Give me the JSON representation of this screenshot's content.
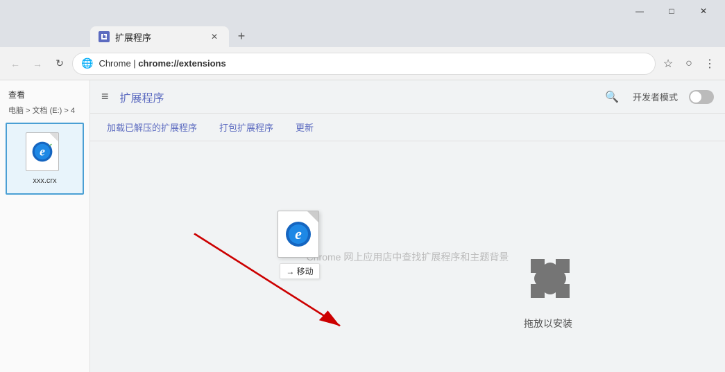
{
  "window": {
    "title": "扩展程序",
    "controls": {
      "minimize": "—",
      "maximize": "□",
      "close": "✕"
    }
  },
  "tab": {
    "icon": "puzzle",
    "title": "扩展程序",
    "close": "✕",
    "new_tab": "+"
  },
  "address_bar": {
    "back": "←",
    "forward": "→",
    "reload": "↻",
    "url_prefix": "Chrome | ",
    "url_bold": "chrome://extensions",
    "star": "☆",
    "account": "○",
    "menu": "⋮"
  },
  "sidebar": {
    "view_label": "查看",
    "breadcrumb": "电脑 > 文档 (E:) > 4",
    "file": {
      "name": "xxx.crx"
    }
  },
  "extensions_page": {
    "header": {
      "menu_icon": "≡",
      "title": "扩展程序",
      "search_icon": "🔍",
      "dev_mode_label": "开发者模式"
    },
    "subnav": {
      "items": [
        "加载已解压的扩展程序",
        "打包扩展程序",
        "更新"
      ]
    },
    "empty_hint": "Chrome 网上应用店中查找扩展程序和主题背景",
    "drag_scene": {
      "floating_file_label": "→ 移动",
      "drop_label": "拖放以安装"
    }
  }
}
